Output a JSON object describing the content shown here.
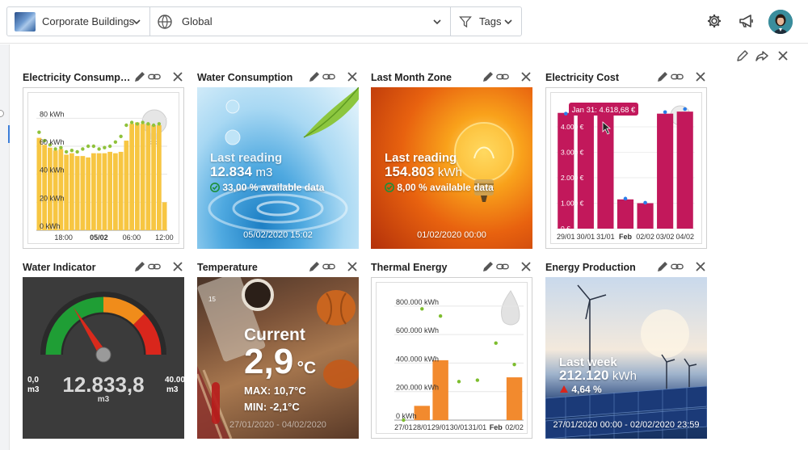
{
  "topbar": {
    "building_filter": "Corporate Buildings",
    "scope_filter": "Global",
    "tags_filter": "Tags",
    "icons": [
      "gear-icon",
      "megaphone-icon"
    ]
  },
  "widgets": {
    "electricity_consumption": {
      "title": "Electricity Consumpt...",
      "chart_data": {
        "type": "bar",
        "series": [
          {
            "name": "",
            "type": "bar",
            "color": "#f7c642",
            "values": [
              66,
              61,
              59,
              57,
              58,
              54,
              55,
              53,
              53,
              52,
              55,
              55,
              55,
              56,
              55,
              56,
              64,
              76,
              77,
              76,
              76,
              75,
              75,
              20
            ]
          },
          {
            "name": "",
            "type": "dots",
            "color": "#8fc23b",
            "values": [
              70,
              64,
              61,
              58,
              59,
              56,
              57,
              56,
              58,
              60,
              60,
              58,
              59,
              60,
              63,
              67,
              75,
              77,
              76,
              77,
              76,
              75,
              76
            ]
          }
        ],
        "ytick_labels": [
          "0 kWh",
          "20 kWh",
          "40 kWh",
          "60 kWh",
          "80 kWh"
        ],
        "yticks": [
          0,
          20,
          40,
          60,
          80
        ],
        "ylim": [
          0,
          90
        ],
        "xtick_labels": [
          "18:00",
          "05/02",
          "06:00",
          "12:00"
        ],
        "bold_tick": "05/02"
      }
    },
    "water_consumption": {
      "title": "Water Consumption",
      "label": "Last reading",
      "value": "12.834",
      "unit": "m3",
      "availability": "33,00 % available data",
      "date": "05/02/2020 15:02"
    },
    "last_month_zone": {
      "title": "Last Month Zone",
      "label": "Last reading",
      "value": "154.803",
      "unit": "kWh",
      "availability": "8,00 % available data",
      "date": "01/02/2020 00:00"
    },
    "electricity_cost": {
      "title": "Electricity Cost",
      "tooltip": "Jan 31: 4.618,68 €",
      "chart_data": {
        "type": "bar",
        "color": "#c2185b",
        "dot_color": "#2b7de9",
        "categories": [
          "29/01",
          "30/01",
          "31/01",
          "Feb",
          "02/02",
          "03/02",
          "04/02"
        ],
        "xtick_text": [
          "29/01",
          "30/01",
          "31/01",
          "Feb",
          "02/02",
          "03/02",
          "04/02"
        ],
        "values": [
          4550,
          4550,
          4618.68,
          1150,
          1000,
          4520,
          4600
        ],
        "dots": [
          4520,
          4520,
          4520,
          1180,
          1020,
          4580,
          4700
        ],
        "ytick_labels": [
          "0 €",
          "1.000 €",
          "2.000 €",
          "3.000 €",
          "4.000 €"
        ],
        "yticks": [
          0,
          1000,
          2000,
          3000,
          4000
        ],
        "ylim": [
          0,
          4700
        ]
      }
    },
    "water_indicator": {
      "title": "Water Indicator",
      "min": "0,0",
      "max": "40.00",
      "unit": "m3",
      "value": "12.833,8",
      "gauge_fraction": 0.32
    },
    "temperature": {
      "title": "Temperature",
      "label": "Current",
      "value": "2,9",
      "unit": "°C",
      "max": "MAX: 10,7°C",
      "min": "MIN: -2,1°C",
      "date": "27/01/2020 - 04/02/2020",
      "thermo_tick": "15"
    },
    "thermal_energy": {
      "title": "Thermal Energy",
      "chart_data": {
        "type": "bar",
        "color": "#f28a2e",
        "dot_color": "#7dbd2d",
        "categories": [
          "27/01",
          "28/01",
          "29/01",
          "30/01",
          "31/01",
          "Feb",
          "02/02"
        ],
        "xtick_text": [
          "27/01",
          "28/01",
          "29/01",
          "30/01",
          "31/01",
          "Feb",
          "02/02"
        ],
        "values": [
          0,
          100000,
          420000,
          0,
          0,
          0,
          300000
        ],
        "dots": [
          0,
          780000,
          730000,
          270000,
          280000,
          540000,
          390000
        ],
        "ytick_labels": [
          "0 kWh",
          "200.000 kWh",
          "400.000 kWh",
          "600.000 kWh",
          "800.000 kWh"
        ],
        "yticks": [
          0,
          200000,
          400000,
          600000,
          800000
        ],
        "ylim": [
          0,
          850000
        ]
      }
    },
    "energy_production": {
      "title": "Energy Production",
      "label": "Last week",
      "value": "212.120",
      "unit": "kWh",
      "change": "4,64 %",
      "date": "27/01/2020 00:00 - 02/02/2020 23:59"
    }
  }
}
